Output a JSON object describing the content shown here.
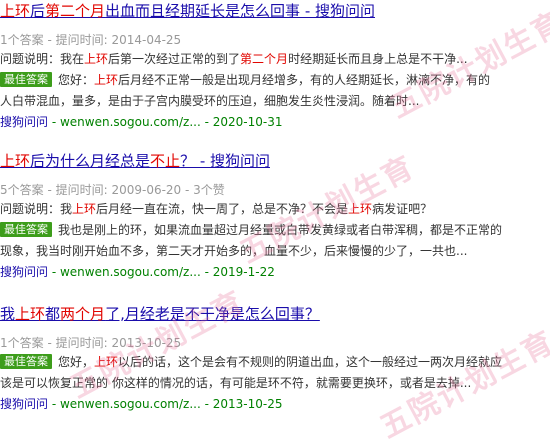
{
  "results": [
    {
      "title": [
        {
          "t": "上环",
          "h": true
        },
        {
          "t": "后",
          "h": false
        },
        {
          "t": "第二个月",
          "h": true
        },
        {
          "t": "出血而且经期延长是怎么回事 - 搜狗问问",
          "h": false
        }
      ],
      "meta": "1个答案 - 提问时间: 2014-04-25",
      "question": [
        {
          "t": "问题说明：我在",
          "h": false
        },
        {
          "t": "上环",
          "h": true
        },
        {
          "t": "后第一次经过正常的到了",
          "h": false
        },
        {
          "t": "第二个月",
          "h": true
        },
        {
          "t": "时经期延长而且身上总是不干净...",
          "h": false
        }
      ],
      "badge": "最佳答案",
      "answer1": [
        {
          "t": "您好：",
          "h": false
        },
        {
          "t": "上环",
          "h": true
        },
        {
          "t": "后月经不正常一般是出现月经增多，有的人经期延长，淋漓不净，有的",
          "h": false
        }
      ],
      "answer2": "人白带混血，量多，是由于子宫内膜受环的压迫，细胞发生炎性浸润。随着时...",
      "source_site": "搜狗问问",
      "source_url": " - wenwen.sogou.com/z...",
      "source_date": " - 2020-10-31"
    },
    {
      "title": [
        {
          "t": "上环",
          "h": true
        },
        {
          "t": "后为什么月经总是",
          "h": false
        },
        {
          "t": "不止",
          "h": true
        },
        {
          "t": "？ - 搜狗问问",
          "h": false
        }
      ],
      "meta": "5个答案 - 提问时间: 2009-06-20 - 3个赞",
      "question": [
        {
          "t": "问题说明：我",
          "h": false
        },
        {
          "t": "上环",
          "h": true
        },
        {
          "t": "后月经一直在流，快一周了，总是不净？不会是",
          "h": false
        },
        {
          "t": "上环",
          "h": true
        },
        {
          "t": "病发证吧？",
          "h": false
        }
      ],
      "badge": "最佳答案",
      "answer1": [
        {
          "t": "我也是刚上的环，如果流血量超过月经量或白带发黄绿或者白带浑稠，都是不正常的",
          "h": false
        }
      ],
      "answer2": "现象，我当时刚开始血不多，第二天才开始多的，血量不少，后来慢慢的少了，一共也...",
      "source_site": "搜狗问问",
      "source_url": " - wenwen.sogou.com/z...",
      "source_date": " - 2019-1-22"
    },
    {
      "title": [
        {
          "t": "我",
          "h": false
        },
        {
          "t": "上环",
          "h": true
        },
        {
          "t": "都",
          "h": false
        },
        {
          "t": "两个月",
          "h": true
        },
        {
          "t": "了,月经老是不干净是怎么回事？",
          "h": false
        }
      ],
      "meta": "1个答案 - 提问时间: 2013-10-25",
      "badge": "最佳答案",
      "answer1": [
        {
          "t": "您好，",
          "h": false
        },
        {
          "t": "上环",
          "h": true
        },
        {
          "t": "以后的话，这个是会有不规则的阴道出血，这个一般经过一两次月经就应",
          "h": false
        }
      ],
      "answer2": "该是可以恢复正常的 你这样的情况的话，有可能是环不符，就需要更换环，或者是去掉...",
      "source_site": "搜狗问问",
      "source_url": " - wenwen.sogou.com/z...",
      "source_date": " - 2013-10-25"
    }
  ],
  "watermark": "五院计划生育"
}
